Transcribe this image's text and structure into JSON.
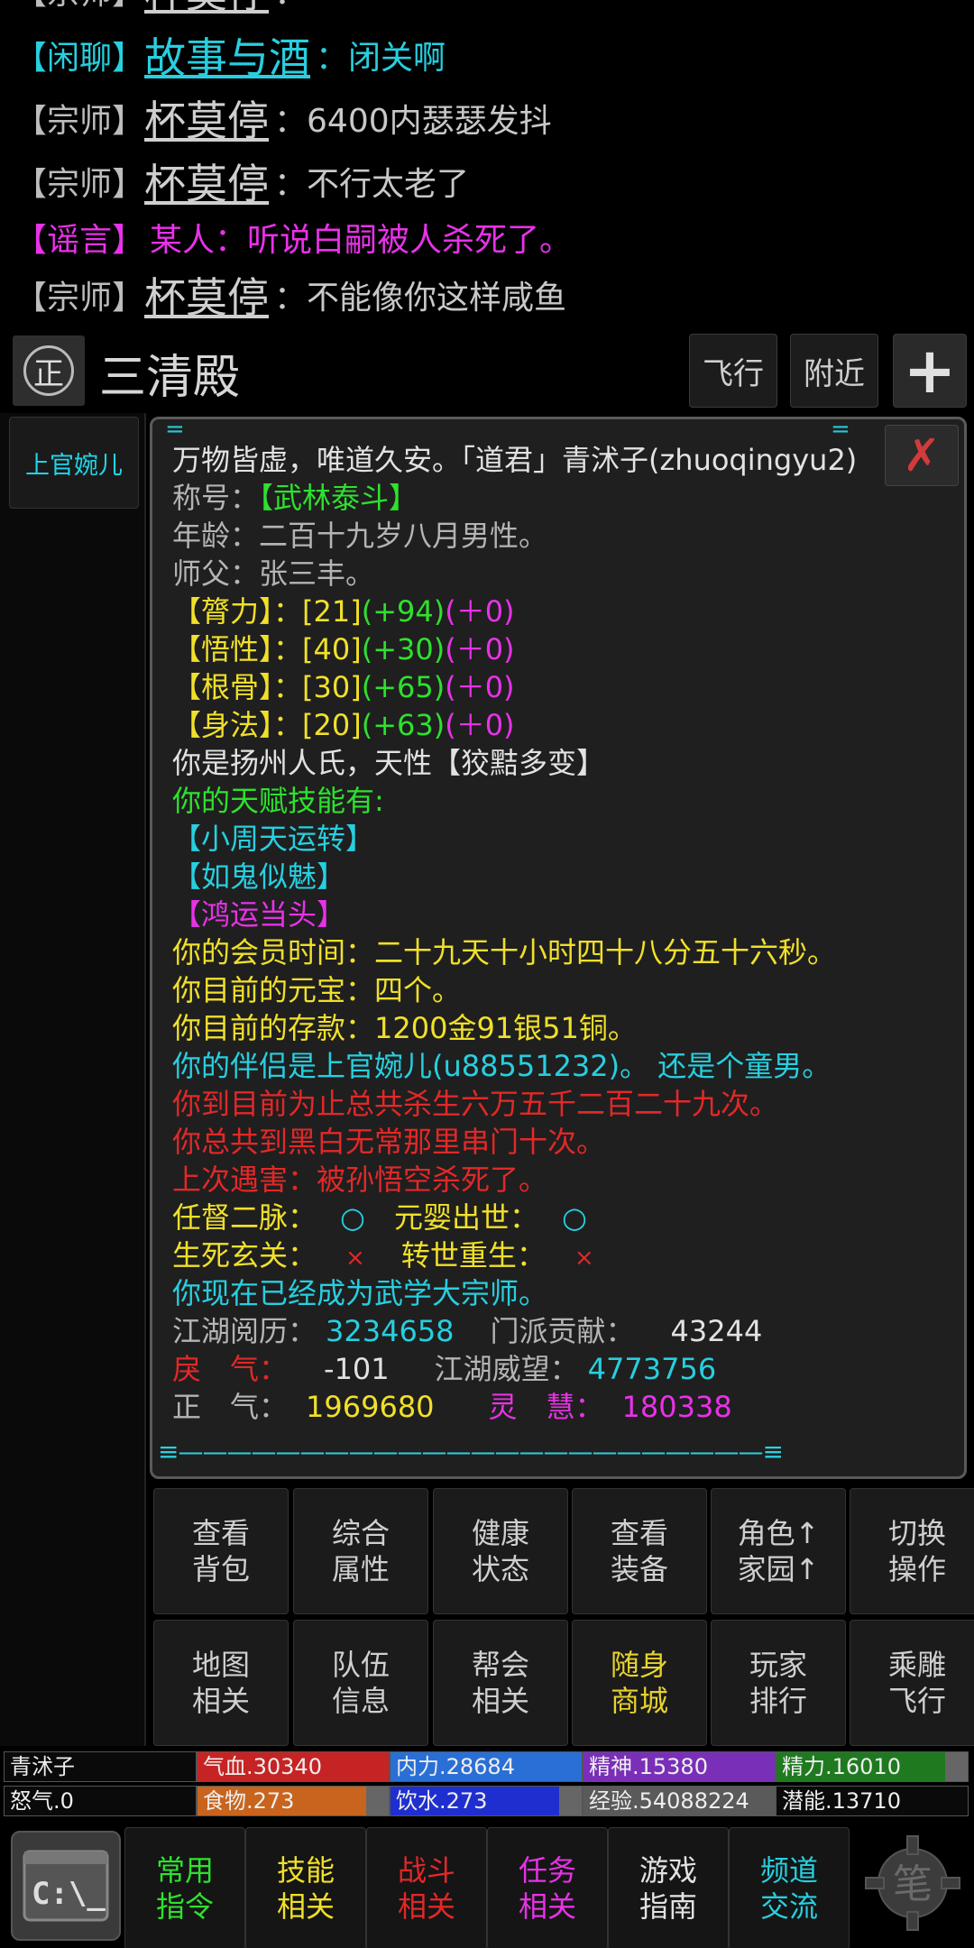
{
  "chat": [
    {
      "tag": "【闲聊】",
      "tag_color": "#27cfe0",
      "name": "故事与酒",
      "name_color": "#27cfe0",
      "msg": "：闭关啊",
      "msg_color": "#27cfe0"
    },
    {
      "tag": "【宗师】",
      "tag_color": "#bdbdbd",
      "name": "杯莫停",
      "name_color": "#cfcfcf",
      "msg": "：6400内瑟瑟发抖",
      "msg_color": "#c8c8c8"
    },
    {
      "tag": "【宗师】",
      "tag_color": "#bdbdbd",
      "name": "杯莫停",
      "name_color": "#cfcfcf",
      "msg": "：不行太老了",
      "msg_color": "#c8c8c8"
    },
    {
      "tag": "【谣言】",
      "tag_color": "#e832e8",
      "name": "",
      "name_color": "#e832e8",
      "msg": "某人：听说白嗣被人杀死了。",
      "msg_color": "#e832e8"
    },
    {
      "tag": "【宗师】",
      "tag_color": "#bdbdbd",
      "name": "杯莫停",
      "name_color": "#cfcfcf",
      "msg": "：不能像你这样咸鱼",
      "msg_color": "#c8c8c8"
    }
  ],
  "location": {
    "badge": "正",
    "name": "三清殿",
    "fly": "飞行",
    "nearby": "附近",
    "plus": "+"
  },
  "sidebar": {
    "items": [
      "上官婉儿"
    ]
  },
  "panel": {
    "close": "✗",
    "top_mark": "=",
    "line1": "万物皆虚，唯道久安。「道君」青沭子(zhuoqingyu2)",
    "title_label": "称号：",
    "title_value": "【武林泰斗】",
    "age": "年龄：二百十九岁八月男性。",
    "master": "师父：张三丰。",
    "attrs": [
      {
        "label": "【膂力】：",
        "base": "[21]",
        "bonus": "(+94)",
        "extra": "(＋0)"
      },
      {
        "label": "【悟性】：",
        "base": "[40]",
        "bonus": "(+30)",
        "extra": "(＋0)"
      },
      {
        "label": "【根骨】：",
        "base": "[30]",
        "bonus": "(+65)",
        "extra": "(＋0)"
      },
      {
        "label": "【身法】：",
        "base": "[20]",
        "bonus": "(+63)",
        "extra": "(＋0)"
      }
    ],
    "origin": "你是扬州人氏，天性【狡黠多变】",
    "talent_head": "你的天赋技能有:",
    "talents": [
      {
        "text": "【小周天运转】",
        "color": "#27cfe0"
      },
      {
        "text": "【如鬼似魅】",
        "color": "#27cfe0"
      },
      {
        "text": "【鸿运当头】",
        "color": "#e832e8"
      }
    ],
    "vip": "你的会员时间：二十九天十小时四十八分五十六秒。",
    "yuanbao": "你目前的元宝：四个。",
    "deposit": "你目前的存款：1200金91银51铜。",
    "partner": "你的伴侣是上官婉儿(u88551232)。 还是个童男。",
    "kills": "你到目前为止总共杀生六万五千二百二十九次。",
    "visits": "你总共到黑白无常那里串门十次。",
    "last_death": "上次遇害：被孙悟空杀死了。",
    "meridian_label": "任督二脉：",
    "meridian_val": "○",
    "yuanying_label": "元婴出世：",
    "yuanying_val": "○",
    "life_label": "生死玄关：",
    "life_val": "×",
    "reborn_label": "转世重生：",
    "reborn_val": "×",
    "grandmaster": "你现在已经成为武学大宗师。",
    "exp_label": "江湖阅历：",
    "exp_val": "3234658",
    "contrib_label": "门派贡献：",
    "contrib_val": "43244",
    "evil_label": "戾　气：",
    "evil_val": "-101",
    "prestige_label": "江湖威望：",
    "prestige_val": "4773756",
    "righteous_label": "正　气：",
    "righteous_val": "1969680",
    "spirit_label": "灵　慧：",
    "spirit_val": "180338",
    "separator": "≡————————————————————————≡"
  },
  "actions": [
    {
      "line1": "查看",
      "line2": "背包",
      "highlight": false
    },
    {
      "line1": "综合",
      "line2": "属性",
      "highlight": false
    },
    {
      "line1": "健康",
      "line2": "状态",
      "highlight": false
    },
    {
      "line1": "查看",
      "line2": "装备",
      "highlight": false
    },
    {
      "line1": "角色↑",
      "line2": "家园↑",
      "highlight": false
    },
    {
      "line1": "切换",
      "line2": "操作",
      "highlight": false
    },
    {
      "line1": "地图",
      "line2": "相关",
      "highlight": false
    },
    {
      "line1": "队伍",
      "line2": "信息",
      "highlight": false
    },
    {
      "line1": "帮会",
      "line2": "相关",
      "highlight": false
    },
    {
      "line1": "随身",
      "line2": "商城",
      "highlight": true
    },
    {
      "line1": "玩家",
      "line2": "排行",
      "highlight": false
    },
    {
      "line1": "乘雕",
      "line2": "飞行",
      "highlight": false
    }
  ],
  "stats": [
    {
      "text": "青沭子",
      "color": "#0a0a0a",
      "fill": 0
    },
    {
      "text": "气血.30340",
      "color": "#c62424",
      "fill": 1.0
    },
    {
      "text": "内力.28684",
      "color": "#2a6fd6",
      "fill": 1.0
    },
    {
      "text": "精神.15380",
      "color": "#7a2fb8",
      "fill": 1.0
    },
    {
      "text": "精力.16010",
      "color": "#1f7a1f",
      "fill": 0.88
    },
    {
      "text": "怒气.0",
      "color": "#0a0a0a",
      "fill": 0
    },
    {
      "text": "食物.273",
      "color": "#c8641e",
      "fill": 0.88
    },
    {
      "text": "饮水.273",
      "color": "#1f2fcf",
      "fill": 0.88
    },
    {
      "text": "经验.54088224",
      "color": "#5a5a5a",
      "fill": 1.0
    },
    {
      "text": "潜能.13710",
      "color": "#0a0a0a",
      "fill": 0
    }
  ],
  "bottom_nav": [
    {
      "line1": "常用",
      "line2": "指令",
      "color": "#2ee12e"
    },
    {
      "line1": "技能",
      "line2": "相关",
      "color": "#f0e02a"
    },
    {
      "line1": "战斗",
      "line2": "相关",
      "color": "#e22828"
    },
    {
      "line1": "任务",
      "line2": "相关",
      "color": "#e832e8"
    },
    {
      "line1": "游戏",
      "line2": "指南",
      "color": "#e2e2e2"
    },
    {
      "line1": "频道",
      "line2": "交流",
      "color": "#27cfe0"
    }
  ],
  "cmd_icon": "C:\\_",
  "gear_char": "笔"
}
